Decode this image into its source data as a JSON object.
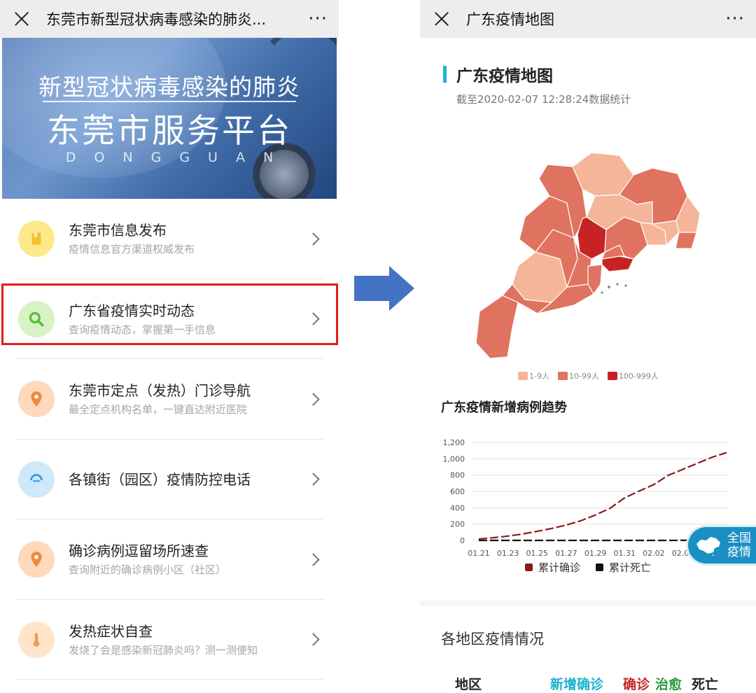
{
  "left": {
    "title": "东莞市新型冠状病毒感染的肺炎...",
    "more": "···",
    "banner": {
      "line1": "新型冠状病毒感染的肺炎",
      "line2": "东莞市服务平台",
      "line3": "DONGGUAN"
    },
    "menu": [
      {
        "title": "东莞市信息发布",
        "subtitle": "疫情信息官方渠道权威发布",
        "icon": "notice-icon",
        "icon_bg": "#fde98a",
        "icon_fg": "#f3c32c"
      },
      {
        "title": "广东省疫情实时动态",
        "subtitle": "查询疫情动态，掌握第一手信息",
        "icon": "search-icon",
        "icon_bg": "#d7f2c5",
        "icon_fg": "#5cbd3a"
      },
      {
        "title": "东莞市定点（发热）门诊导航",
        "subtitle": "最全定点机构名单，一键直达附近医院",
        "icon": "location-pin-icon",
        "icon_bg": "#ffd9bb",
        "icon_fg": "#f08a3c"
      },
      {
        "title": "各镇街（园区）疫情防控电话",
        "subtitle": "",
        "icon": "phone-icon",
        "icon_bg": "#cfe9fb",
        "icon_fg": "#3b9ae0"
      },
      {
        "title": "确诊病例逗留场所速查",
        "subtitle": "查询附近的确诊病例小区（社区）",
        "icon": "location-pin-icon",
        "icon_bg": "#ffd9bb",
        "icon_fg": "#f08a3c"
      },
      {
        "title": "发热症状自查",
        "subtitle": "发烧了会是感染新冠肺炎吗？测一测便知",
        "icon": "thermometer-icon",
        "icon_bg": "#ffe4cc",
        "icon_fg": "#f09a4c"
      }
    ],
    "highlight_color": "#e31c1c"
  },
  "arrow_color": "#4472c4",
  "right": {
    "title": "广东疫情地图",
    "more": "···",
    "heading": "广东疫情地图",
    "updated": "截至2020-02-07 12:28:24数据统计",
    "map_legend": [
      {
        "label": "1-9人",
        "color": "#f5b59a"
      },
      {
        "label": "10-99人",
        "color": "#e07360"
      },
      {
        "label": "100-999人",
        "color": "#c62424"
      }
    ],
    "trend_title": "广东疫情新增病例趋势",
    "badge": "全国\n疫情",
    "region_title": "各地区疫情情况",
    "table_headers": [
      {
        "label": "地区",
        "color": "#222222"
      },
      {
        "label": "新增确诊",
        "color": "#19b1cf"
      },
      {
        "label": "确诊",
        "color": "#c62424"
      },
      {
        "label": "治愈",
        "color": "#2a9a3a"
      },
      {
        "label": "死亡",
        "color": "#222222"
      }
    ]
  },
  "chart_data": {
    "type": "line",
    "x": [
      "01.21",
      "01.22",
      "01.23",
      "01.24",
      "01.25",
      "01.26",
      "01.27",
      "01.28",
      "01.29",
      "01.30",
      "01.31",
      "02.01",
      "02.02",
      "02.03",
      "02.04",
      "02.05",
      "02.06",
      "02.07"
    ],
    "tick_labels": [
      "01.21",
      "01.23",
      "01.25",
      "01.27",
      "01.29",
      "01.31",
      "02.02",
      "02.04"
    ],
    "ylim": [
      0,
      1200
    ],
    "yticks": [
      "0",
      "200",
      "400",
      "600",
      "800",
      "1,000",
      "1,200"
    ],
    "grid": true,
    "legend_position": "bottom",
    "series": [
      {
        "name": "累计确诊",
        "color": "#8b1a1a",
        "style": "dashed",
        "values": [
          17,
          33,
          53,
          78,
          111,
          146,
          188,
          241,
          311,
          393,
          520,
          604,
          683,
          797,
          870,
          944,
          1018,
          1075
        ]
      },
      {
        "name": "累计死亡",
        "color": "#111111",
        "style": "dashed",
        "values": [
          0,
          0,
          0,
          0,
          0,
          0,
          0,
          0,
          0,
          0,
          0,
          0,
          0,
          0,
          1,
          1,
          1,
          1
        ]
      }
    ]
  }
}
